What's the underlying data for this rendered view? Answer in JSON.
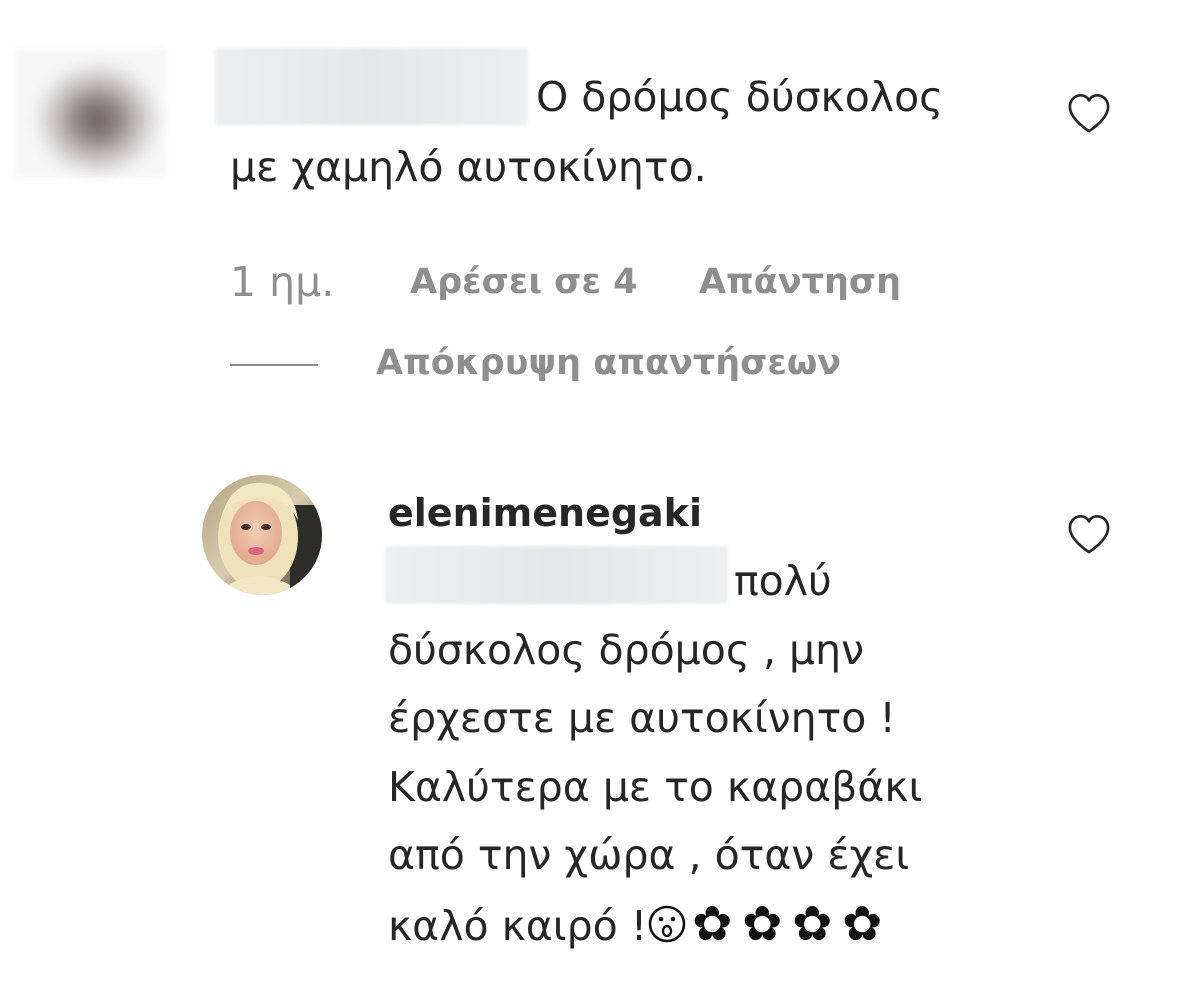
{
  "comment": {
    "line1": "Ο δρόμος δύσκολος",
    "line2": "με χαμηλό αυτοκίνητο.",
    "time": "1 ημ.",
    "likes": "Αρέσει σε 4",
    "reply": "Απάντηση",
    "hide_replies": "Απόκρυψη απαντήσεων",
    "like_icon": "heart-outline"
  },
  "reply": {
    "username": "elenimenegaki",
    "lines": [
      "πολύ",
      "δύσκολος δρόμος , μην",
      "έρχεστε με αυτοκίνητο !",
      "Καλύτερα με το καραβάκι",
      "από την χώρα , όταν έχει",
      "καλό καιρό !"
    ],
    "emojis": {
      "face": "open-mouth-face",
      "flowers": [
        "✿",
        "✿",
        "✿",
        "✿"
      ]
    },
    "like_icon": "heart-outline"
  }
}
